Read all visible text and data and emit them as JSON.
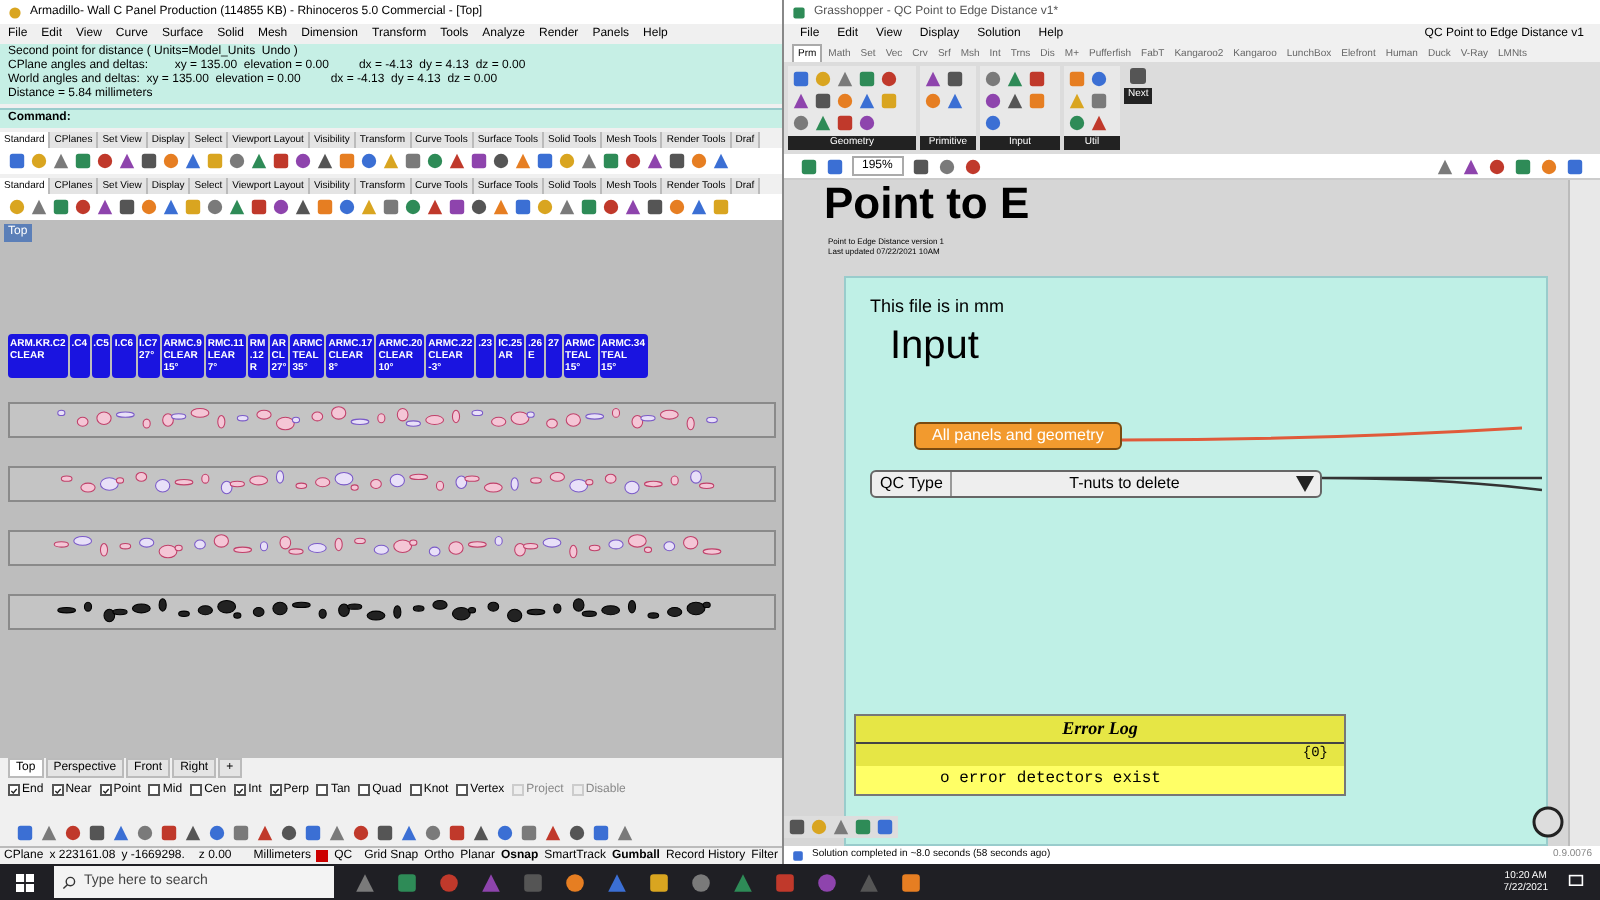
{
  "rhino": {
    "title": "Armadillo- Wall C Panel Production (114855 KB) - Rhinoceros 5.0 Commercial - [Top]",
    "menu": [
      "File",
      "Edit",
      "View",
      "Curve",
      "Surface",
      "Solid",
      "Mesh",
      "Dimension",
      "Transform",
      "Tools",
      "Analyze",
      "Render",
      "Panels",
      "Help"
    ],
    "command_history": [
      "Second point for distance ( Units=Model_Units  Undo )",
      "CPlane angles and deltas:        xy = 135.00  elevation = 0.00         dx = -4.13  dy = 4.13  dz = 0.00",
      "World angles and deltas:  xy = 135.00  elevation = 0.00         dx = -4.13  dy = 4.13  dz = 0.00",
      "Distance = 5.84 millimeters"
    ],
    "command_prompt": "Command:",
    "toolbars": [
      {
        "tabs": [
          {
            "label": "Standard",
            "selected": true
          },
          {
            "label": "CPlanes",
            "selected": false
          },
          {
            "label": "Set View",
            "selected": false
          },
          {
            "label": "Display",
            "selected": false
          },
          {
            "label": "Select",
            "selected": false
          },
          {
            "label": "Viewport Layout",
            "selected": false
          },
          {
            "label": "Visibility",
            "selected": false
          },
          {
            "label": "Transform",
            "selected": false
          },
          {
            "label": "Curve Tools",
            "selected": false
          },
          {
            "label": "Surface Tools",
            "selected": false
          },
          {
            "label": "Solid Tools",
            "selected": false
          },
          {
            "label": "Mesh Tools",
            "selected": false
          },
          {
            "label": "Render Tools",
            "selected": false
          },
          {
            "label": "Draf",
            "selected": false
          }
        ]
      },
      {
        "tabs": [
          {
            "label": "Standard",
            "selected": true
          },
          {
            "label": "CPlanes",
            "selected": false
          },
          {
            "label": "Set View",
            "selected": false
          },
          {
            "label": "Display",
            "selected": false
          },
          {
            "label": "Select",
            "selected": false
          },
          {
            "label": "Viewport Layout",
            "selected": false
          },
          {
            "label": "Visibility",
            "selected": false
          },
          {
            "label": "Transform",
            "selected": false
          },
          {
            "label": "Curve Tools",
            "selected": false
          },
          {
            "label": "Surface Tools",
            "selected": false
          },
          {
            "label": "Solid Tools",
            "selected": false
          },
          {
            "label": "Mesh Tools",
            "selected": false
          },
          {
            "label": "Render Tools",
            "selected": false
          },
          {
            "label": "Draf",
            "selected": false
          }
        ]
      }
    ],
    "viewport_label": "Top",
    "labels": [
      {
        "lines": [
          "ARM.KR.C2",
          "CLEAR"
        ]
      },
      {
        "lines": [
          ".C4"
        ]
      },
      {
        "lines": [
          ".C5"
        ]
      },
      {
        "lines": [
          "I.C6"
        ]
      },
      {
        "lines": [
          "I.C7",
          "27°"
        ]
      },
      {
        "lines": [
          "ARMC.9",
          "CLEAR",
          "15°"
        ]
      },
      {
        "lines": [
          "RMC.11",
          "LEAR",
          "7°"
        ]
      },
      {
        "lines": [
          "RM",
          ".12",
          "R"
        ]
      },
      {
        "lines": [
          "AR",
          "CL",
          "27°"
        ]
      },
      {
        "lines": [
          "ARMC",
          "TEAL",
          "35°"
        ]
      },
      {
        "lines": [
          "ARMC.17",
          "CLEAR",
          "8°"
        ]
      },
      {
        "lines": [
          "ARMC.20",
          "CLEAR",
          "10°"
        ]
      },
      {
        "lines": [
          "ARMC.22",
          "CLEAR",
          "-3°"
        ]
      },
      {
        "lines": [
          ".23"
        ]
      },
      {
        "lines": [
          "IC.25",
          "AR"
        ]
      },
      {
        "lines": [
          ".26",
          "E"
        ]
      },
      {
        "lines": [
          "27"
        ]
      },
      {
        "lines": [
          "ARMC",
          "TEAL",
          "15°"
        ]
      },
      {
        "lines": [
          "ARMC.34",
          "TEAL",
          "15°"
        ]
      }
    ],
    "viewport_tabs": [
      {
        "label": "Top",
        "selected": true
      },
      {
        "label": "Perspective",
        "selected": false
      },
      {
        "label": "Front",
        "selected": false
      },
      {
        "label": "Right",
        "selected": false
      },
      {
        "label": "+",
        "selected": false
      }
    ],
    "osnaps": [
      {
        "label": "End",
        "checked": true,
        "disabled": false
      },
      {
        "label": "Near",
        "checked": true,
        "disabled": false
      },
      {
        "label": "Point",
        "checked": true,
        "disabled": false
      },
      {
        "label": "Mid",
        "checked": false,
        "disabled": false
      },
      {
        "label": "Cen",
        "checked": false,
        "disabled": false
      },
      {
        "label": "Int",
        "checked": true,
        "disabled": false
      },
      {
        "label": "Perp",
        "checked": true,
        "disabled": false
      },
      {
        "label": "Tan",
        "checked": false,
        "disabled": false
      },
      {
        "label": "Quad",
        "checked": false,
        "disabled": false
      },
      {
        "label": "Knot",
        "checked": false,
        "disabled": false
      },
      {
        "label": "Vertex",
        "checked": false,
        "disabled": false
      },
      {
        "label": "Project",
        "checked": false,
        "disabled": true
      },
      {
        "label": "Disable",
        "checked": false,
        "disabled": true
      }
    ],
    "status": {
      "cplane": "CPlane",
      "x": "x 223161.08",
      "y": "y -1669298.",
      "z": "z 0.00",
      "units": "Millimeters",
      "layer": {
        "name": "QC",
        "color": "#cc0000"
      },
      "panes": [
        {
          "label": "Grid Snap",
          "on": false
        },
        {
          "label": "Ortho",
          "on": false
        },
        {
          "label": "Planar",
          "on": false
        },
        {
          "label": "Osnap",
          "on": true
        },
        {
          "label": "SmartTrack",
          "on": false
        },
        {
          "label": "Gumball",
          "on": true
        },
        {
          "label": "Record History",
          "on": false
        },
        {
          "label": "Filter",
          "on": false
        }
      ]
    }
  },
  "grasshopper": {
    "title": "Grasshopper - QC Point to Edge Distance v1*",
    "menu": [
      "File",
      "Edit",
      "View",
      "Display",
      "Solution",
      "Help"
    ],
    "document_name": "QC Point to Edge Distance v1",
    "tabs": [
      {
        "label": "Prm",
        "selected": true
      },
      {
        "label": "Math",
        "selected": false
      },
      {
        "label": "Set",
        "selected": false
      },
      {
        "label": "Vec",
        "selected": false
      },
      {
        "label": "Crv",
        "selected": false
      },
      {
        "label": "Srf",
        "selected": false
      },
      {
        "label": "Msh",
        "selected": false
      },
      {
        "label": "Int",
        "selected": false
      },
      {
        "label": "Trns",
        "selected": false
      },
      {
        "label": "Dis",
        "selected": false
      },
      {
        "label": "M+",
        "selected": false
      },
      {
        "label": "Pufferfish",
        "selected": false
      },
      {
        "label": "FabT",
        "selected": false
      },
      {
        "label": "Kangaroo2",
        "selected": false
      },
      {
        "label": "Kangaroo",
        "selected": false
      },
      {
        "label": "LunchBox",
        "selected": false
      },
      {
        "label": "Elefront",
        "selected": false
      },
      {
        "label": "Human",
        "selected": false
      },
      {
        "label": "Duck",
        "selected": false
      },
      {
        "label": "V-Ray",
        "selected": false
      },
      {
        "label": "LMNts",
        "selected": false
      }
    ],
    "panel_groups": [
      {
        "label": "Geometry"
      },
      {
        "label": "Primitive"
      },
      {
        "label": "Input"
      },
      {
        "label": "Util"
      }
    ],
    "next_label": "Next",
    "zoom": "195%",
    "canvas": {
      "big_title": "Point to E",
      "group_note": [
        "Point to Edge Distance version 1",
        "Last updated 07/22/2021 10AM"
      ],
      "note": "This file is in mm",
      "heading": "Input",
      "param": "All panels and geometry",
      "value_list": {
        "label": "QC Type",
        "value": "T-nuts to delete"
      },
      "error_log": {
        "title": "Error Log",
        "path": "{0}",
        "message": "o error detectors exist"
      }
    },
    "status": "Solution completed in ~8.0 seconds (58 seconds ago)",
    "version": "0.9.0076"
  },
  "taskbar": {
    "search_placeholder": "Type here to search",
    "time": "10:20 AM",
    "date": "7/22/2021"
  }
}
